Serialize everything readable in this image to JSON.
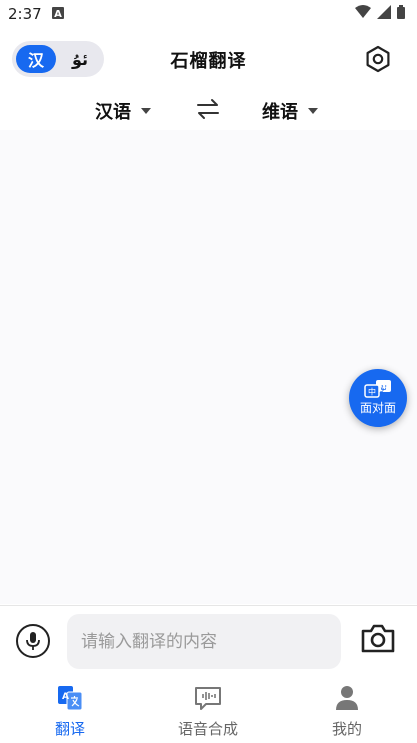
{
  "statusbar": {
    "time": "2:37",
    "notification_icon": "a-icon"
  },
  "header": {
    "title": "石榴翻译",
    "toggle_active": "汉",
    "toggle_inactive": "ئۇ"
  },
  "languages": {
    "source": "汉语",
    "target": "维语"
  },
  "fab": {
    "label": "面对面",
    "badge_cn": "中",
    "badge_ug": "ئۇ"
  },
  "input": {
    "placeholder": "请输入翻译的内容",
    "value": ""
  },
  "tabs": [
    {
      "label": "翻译",
      "active": true
    },
    {
      "label": "语音合成",
      "active": false
    },
    {
      "label": "我的",
      "active": false
    }
  ],
  "colors": {
    "accent": "#1769f0",
    "content_bg": "#fafafc"
  }
}
